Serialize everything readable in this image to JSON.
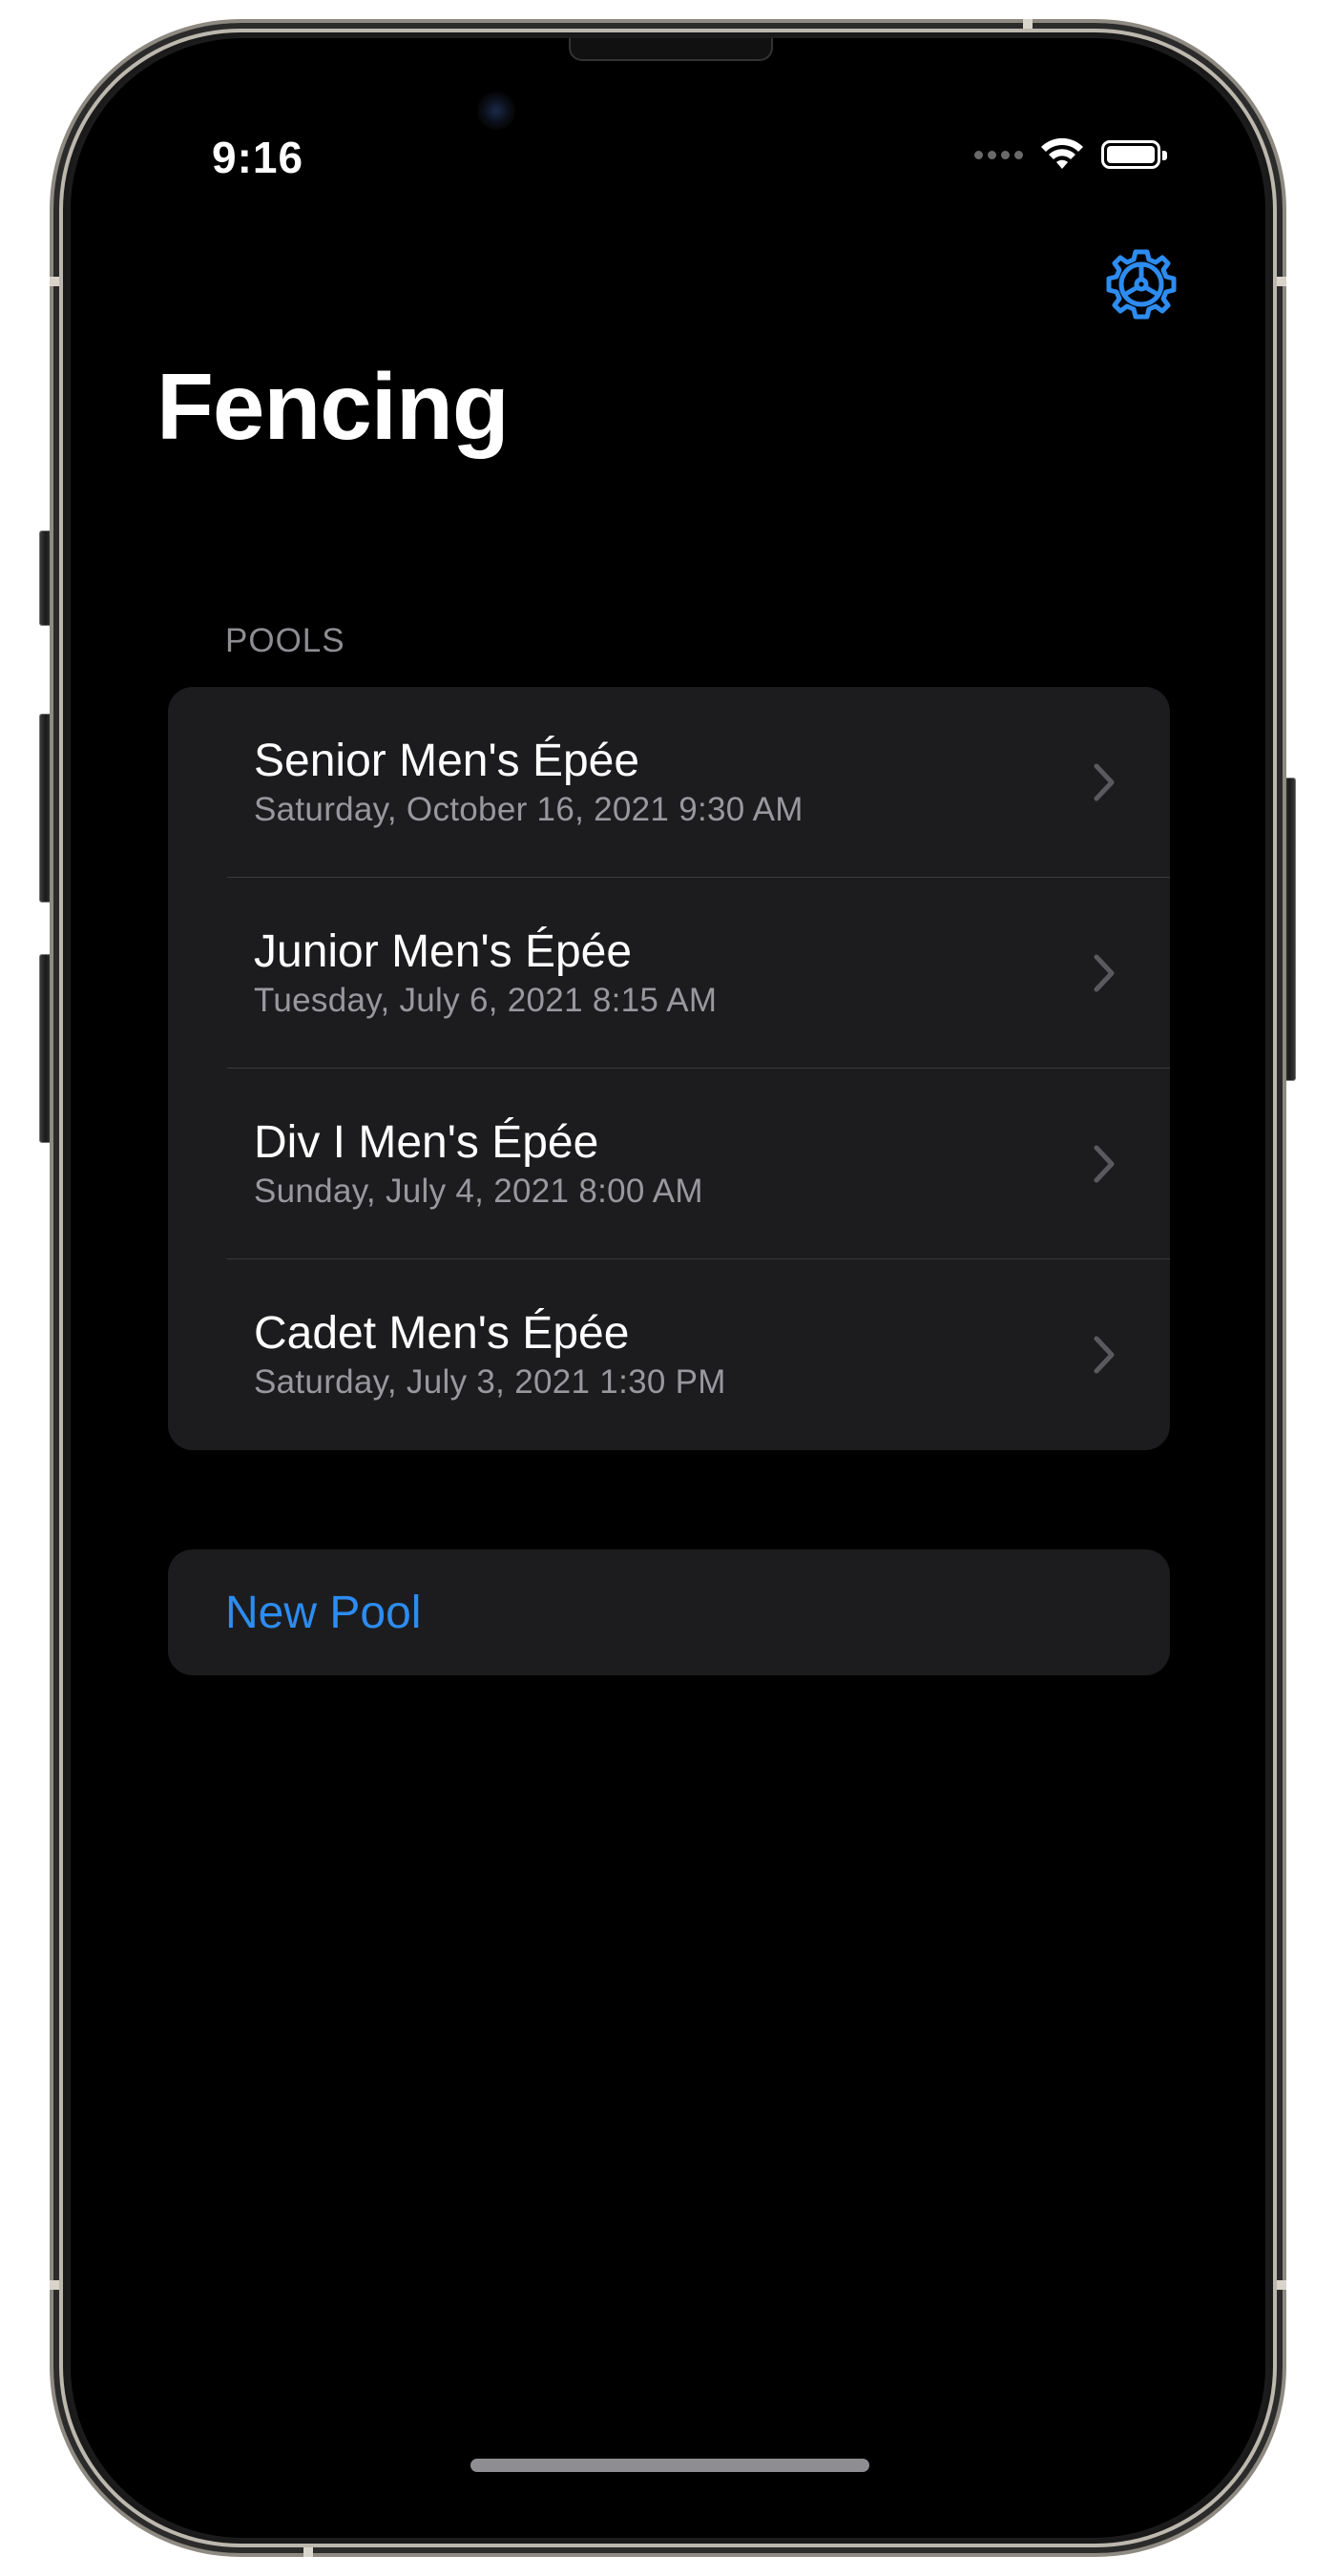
{
  "status_bar": {
    "time": "9:16",
    "icons": [
      "signal-dots-icon",
      "wifi-icon",
      "battery-icon"
    ]
  },
  "nav": {
    "title": "Fencing",
    "settings_icon": "gear-icon"
  },
  "pools": {
    "header": "POOLS",
    "items": [
      {
        "title": "Senior Men's Épée",
        "subtitle": "Saturday, October 16, 2021 9:30 AM"
      },
      {
        "title": "Junior Men's Épée",
        "subtitle": "Tuesday, July 6, 2021 8:15 AM"
      },
      {
        "title": "Div I Men's Épée",
        "subtitle": "Sunday, July 4, 2021 8:00 AM"
      },
      {
        "title": "Cadet Men's Épée",
        "subtitle": "Saturday, July 3, 2021 1:30 PM"
      }
    ]
  },
  "actions": {
    "new_pool_label": "New Pool"
  },
  "colors": {
    "background": "#000000",
    "cell_background": "#1c1c1e",
    "accent": "#2d8cf0",
    "secondary_text": "#98989e"
  }
}
